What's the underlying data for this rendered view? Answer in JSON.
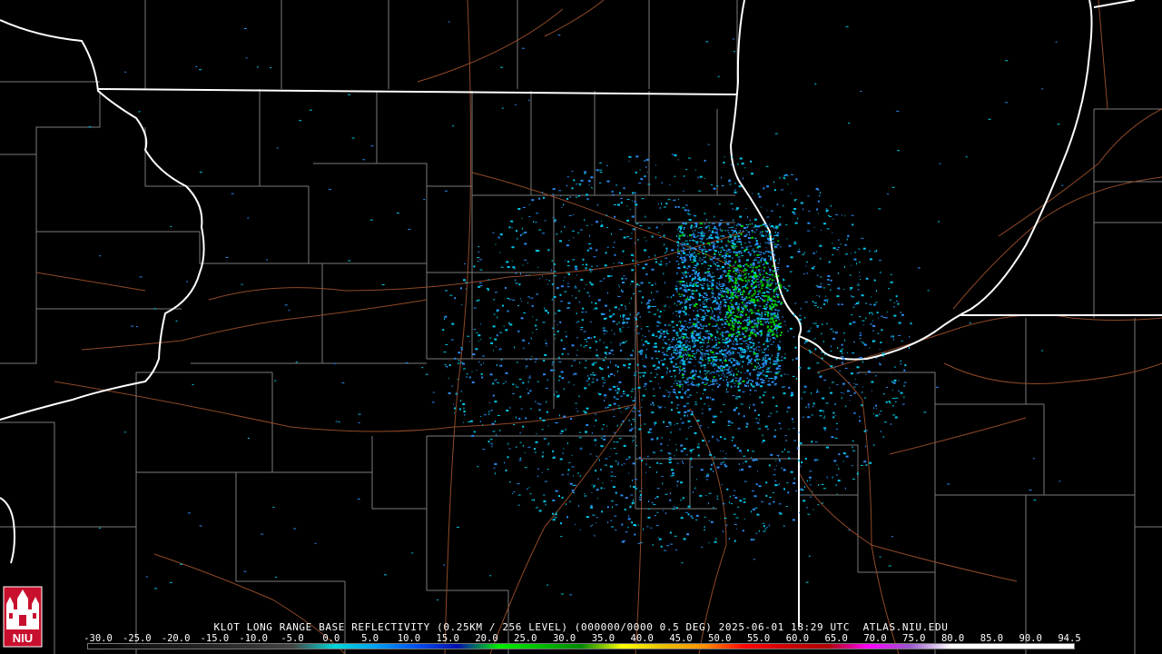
{
  "caption": "KLOT LONG RANGE BASE REFLECTIVITY (0.25KM / 256 LEVEL) (000000/0000 0.5 DEG) 2025-06-01 18:29 UTC  ATLAS.NIU.EDU",
  "logo_text": "NIU",
  "scale_ticks": [
    "-30.0",
    "-25.0",
    "-20.0",
    "-15.0",
    "-10.0",
    "-5.0",
    "0.0",
    "5.0",
    "10.0",
    "15.0",
    "20.0",
    "25.0",
    "30.0",
    "35.0",
    "40.0",
    "45.0",
    "50.0",
    "55.0",
    "60.0",
    "65.0",
    "70.0",
    "75.0",
    "80.0",
    "85.0",
    "90.0",
    "94.5"
  ],
  "scale_colors": [
    "#000000",
    "#101010",
    "#1a1a1a",
    "#262626",
    "#333333",
    "#444444",
    "#00d8d8",
    "#00a0f0",
    "#0050f0",
    "#0010b0",
    "#00f000",
    "#00c000",
    "#008800",
    "#ffff00",
    "#e8c000",
    "#ff9000",
    "#ff0000",
    "#d00000",
    "#b00000",
    "#ff00ff",
    "#9955cc",
    "#ffffff",
    "#ffffff",
    "#ffffff",
    "#ffffff"
  ],
  "colors": {
    "background": "#000000",
    "state_line": "#ffffff",
    "county_line": "#7a7a7a",
    "road": "#a0522d",
    "echo_cyan": "#00c8e8",
    "echo_blue": "#2a8af0",
    "echo_green": "#00d000",
    "logo_red": "#c8102e"
  }
}
